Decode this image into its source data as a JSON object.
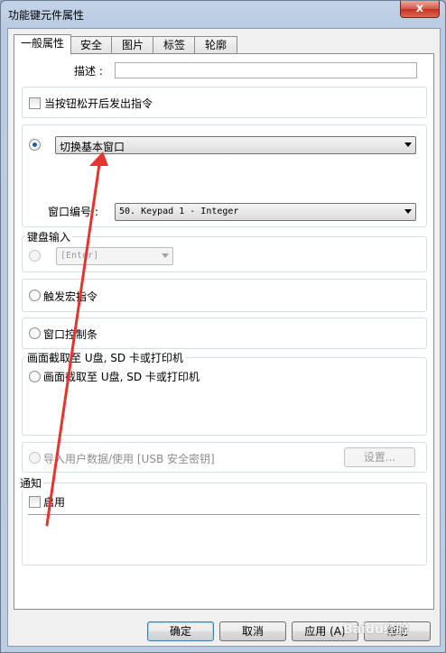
{
  "window": {
    "title": "功能键元件属性",
    "close": "x"
  },
  "tabs": [
    {
      "label": "一般属性",
      "active": true
    },
    {
      "label": "安全"
    },
    {
      "label": "图片"
    },
    {
      "label": "标签"
    },
    {
      "label": "轮廓"
    }
  ],
  "general": {
    "desc_label": "描述 :",
    "desc_value": "",
    "release_cmd_label": "当按钮松开后发出指令",
    "switch_window_label": "切换基本窗口",
    "window_no_label": "窗口编号 :",
    "window_no_value": "50. Keypad 1 - Integer",
    "keyboard_group": "键盘输入",
    "keyboard_value": "[Enter]",
    "macro_label": "触发宏指令",
    "window_bar_label": "窗口控制条",
    "capture_group": "画面截取至 U盘, SD 卡或打印机",
    "capture_label": "画面截取",
    "import_label": "导入用户数据/使用 [USB 安全密钥]",
    "settings_button": "设置...",
    "notify_group": "通知",
    "enable_label": "启用"
  },
  "footer": {
    "ok": "确定",
    "cancel": "取消",
    "apply": "应用 (A)",
    "help": "帮助"
  },
  "colors": {
    "annotation": "#e8322d",
    "accent": "#1d5fa8"
  },
  "watermark": "Baidu经验"
}
